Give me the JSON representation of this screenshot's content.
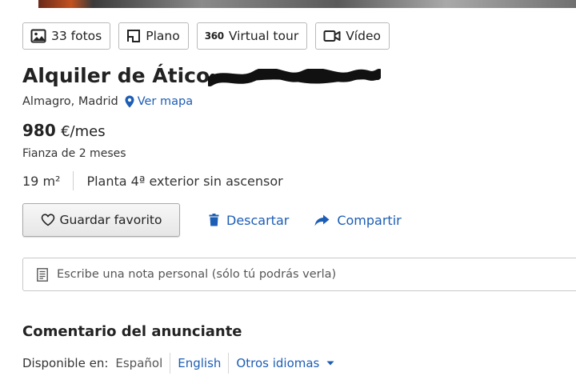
{
  "media": {
    "photos_label": "33 fotos",
    "plan_label": "Plano",
    "tour_badge": "360",
    "tour_label": "Virtual tour",
    "video_label": "Vídeo"
  },
  "listing": {
    "title": "Alquiler de Ático",
    "location": "Almagro, Madrid",
    "map_link": "Ver mapa",
    "price_amount": "980",
    "price_unit": "€/mes",
    "deposit": "Fianza de 2 meses",
    "area": "19 m²",
    "floor": "Planta 4ª exterior sin ascensor"
  },
  "actions": {
    "favorite_label": "Guardar favorito",
    "discard_label": "Descartar",
    "share_label": "Compartir"
  },
  "note": {
    "placeholder": "Escribe una nota personal (sólo tú podrás verla)"
  },
  "comment": {
    "title": "Comentario del anunciante",
    "available_label": "Disponible en:",
    "languages": [
      "Español",
      "English"
    ],
    "other_languages": "Otros idiomas"
  },
  "colors": {
    "link": "#1c5db5",
    "text": "#222222",
    "border": "#b9b9b9"
  },
  "icons": [
    "photo-icon",
    "floor-plan-icon",
    "video-camera-icon",
    "map-pin-icon",
    "heart-icon",
    "trash-icon",
    "share-arrow-icon",
    "note-icon",
    "chevron-down-icon"
  ]
}
